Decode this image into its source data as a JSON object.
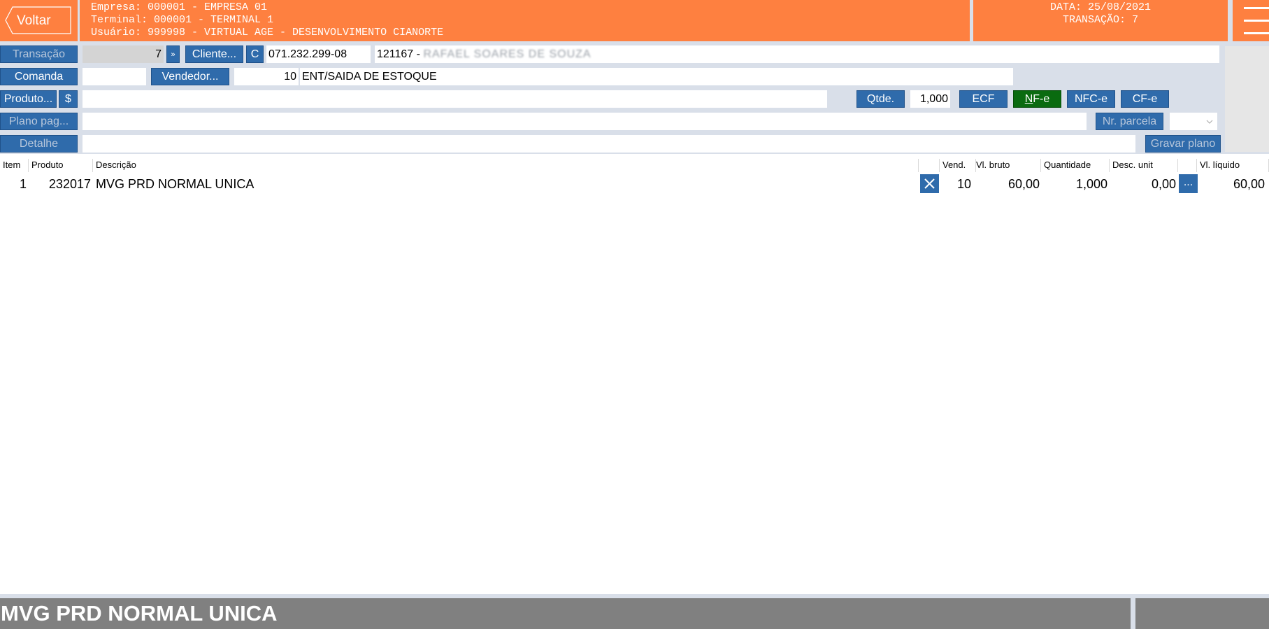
{
  "header": {
    "back_label": "Voltar",
    "empresa": "Empresa: 000001 - EMPRESA 01",
    "terminal": "Terminal: 000001 - TERMINAL 1",
    "usuario": "Usuário: 999998 - VIRTUAL AGE - DESENVOLVIMENTO CIANORTE",
    "data": "DATA: 25/08/2021",
    "transacao": "TRANSAÇÃO: 7",
    "menu_icon": "hamburger-menu-icon"
  },
  "form": {
    "transacao_btn": "Transação",
    "transacao_value": "7",
    "next_btn": "»",
    "cliente_btn": "Cliente...",
    "c_btn": "C",
    "cpf": "071.232.299-08",
    "cliente_code": "121167 -",
    "cliente_name": "RAFAEL SOARES DE SOUZA",
    "comanda_btn": "Comanda",
    "comanda_value": "",
    "vendedor_btn": "Vendedor...",
    "vendedor_code": "10",
    "vendedor_name": "ENT/SAIDA DE ESTOQUE",
    "produto_btn": "Produto...",
    "dollar_btn": "$",
    "produto_value": "",
    "qtde_btn": "Qtde.",
    "qtde_value": "1,000",
    "ecf_btn": "ECF",
    "nfe_btn": "NF-e",
    "nfce_btn": "NFC-e",
    "cfe_btn": "CF-e",
    "plano_btn": "Plano pag...",
    "plano_value": "",
    "nr_parcela_btn": "Nr. parcela",
    "detalhe_btn": "Detalhe",
    "detalhe_value": "",
    "gravar_btn": "Gravar plano"
  },
  "grid": {
    "columns": [
      "Item",
      "Produto",
      "Descrição",
      "",
      "Vend.",
      "Vl. bruto",
      "Quantidade",
      "Desc. unit",
      "",
      "Vl. líquido"
    ],
    "rows": [
      {
        "item": "1",
        "produto": "232017",
        "descricao": "MVG PRD NORMAL UNICA",
        "vend": "10",
        "vl_bruto": "60,00",
        "quantidade": "1,000",
        "desc_unit": "0,00",
        "more": "...",
        "vl_liquido": "60,00"
      }
    ]
  },
  "footer": {
    "product_name": "MVG PRD NORMAL UNICA"
  },
  "colors": {
    "orange": "#fe8040",
    "blue": "#2f6bab",
    "green": "#0a6b10",
    "panel": "#d9dfe9"
  }
}
